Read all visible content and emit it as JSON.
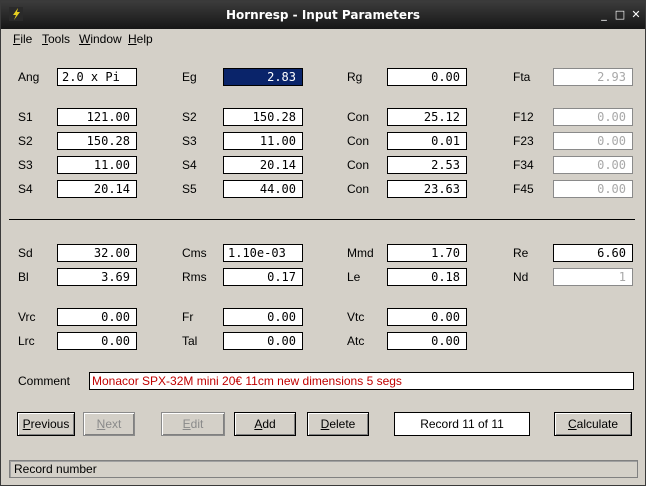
{
  "window": {
    "title": "Hornresp - Input Parameters",
    "minimize": "_",
    "maximize": "□",
    "close": "✕"
  },
  "menu": [
    "File",
    "Tools",
    "Window",
    "Help"
  ],
  "rows": [
    {
      "cells": [
        {
          "label": "Ang",
          "value": "2.0 x Pi",
          "state": "text"
        },
        {
          "label": "Eg",
          "value": "2.83",
          "state": "selected"
        },
        {
          "label": "Rg",
          "value": "0.00",
          "state": "normal"
        },
        {
          "label": "Fta",
          "value": "2.93",
          "state": "disabled"
        }
      ]
    },
    {
      "cells": [
        {
          "label": "S1",
          "value": "121.00",
          "state": "normal"
        },
        {
          "label": "S2",
          "value": "150.28",
          "state": "normal"
        },
        {
          "label": "Con",
          "value": "25.12",
          "state": "normal"
        },
        {
          "label": "F12",
          "value": "0.00",
          "state": "disabled"
        }
      ]
    },
    {
      "cells": [
        {
          "label": "S2",
          "value": "150.28",
          "state": "normal"
        },
        {
          "label": "S3",
          "value": "11.00",
          "state": "normal"
        },
        {
          "label": "Con",
          "value": "0.01",
          "state": "normal"
        },
        {
          "label": "F23",
          "value": "0.00",
          "state": "disabled"
        }
      ]
    },
    {
      "cells": [
        {
          "label": "S3",
          "value": "11.00",
          "state": "normal"
        },
        {
          "label": "S4",
          "value": "20.14",
          "state": "normal"
        },
        {
          "label": "Con",
          "value": "2.53",
          "state": "normal"
        },
        {
          "label": "F34",
          "value": "0.00",
          "state": "disabled"
        }
      ]
    },
    {
      "cells": [
        {
          "label": "S4",
          "value": "20.14",
          "state": "normal"
        },
        {
          "label": "S5",
          "value": "44.00",
          "state": "normal"
        },
        {
          "label": "Con",
          "value": "23.63",
          "state": "normal"
        },
        {
          "label": "F45",
          "value": "0.00",
          "state": "disabled"
        }
      ]
    },
    {
      "cells": [
        {
          "label": "Sd",
          "value": "32.00",
          "state": "normal"
        },
        {
          "label": "Cms",
          "value": "1.10e-03",
          "state": "text"
        },
        {
          "label": "Mmd",
          "value": "1.70",
          "state": "normal"
        },
        {
          "label": "Re",
          "value": "6.60",
          "state": "normal"
        }
      ]
    },
    {
      "cells": [
        {
          "label": "Bl",
          "value": "3.69",
          "state": "normal"
        },
        {
          "label": "Rms",
          "value": "0.17",
          "state": "normal"
        },
        {
          "label": "Le",
          "value": "0.18",
          "state": "normal"
        },
        {
          "label": "Nd",
          "value": "1",
          "state": "disabled"
        }
      ]
    },
    {
      "cells": [
        {
          "label": "Vrc",
          "value": "0.00",
          "state": "normal"
        },
        {
          "label": "Fr",
          "value": "0.00",
          "state": "normal"
        },
        {
          "label": "Vtc",
          "value": "0.00",
          "state": "normal"
        }
      ]
    },
    {
      "cells": [
        {
          "label": "Lrc",
          "value": "0.00",
          "state": "normal"
        },
        {
          "label": "Tal",
          "value": "0.00",
          "state": "normal"
        },
        {
          "label": "Atc",
          "value": "0.00",
          "state": "normal"
        }
      ]
    }
  ],
  "comment": {
    "label": "Comment",
    "value": "Monacor SPX-32M mini 20€ 11cm new dimensions 5 segs"
  },
  "buttons": [
    {
      "name": "previous-button",
      "label": "Previous",
      "enabled": true
    },
    {
      "name": "next-button",
      "label": "Next",
      "enabled": false
    },
    {
      "name": "edit-button",
      "label": "Edit",
      "enabled": false
    },
    {
      "name": "add-button",
      "label": "Add",
      "enabled": true
    },
    {
      "name": "delete-button",
      "label": "Delete",
      "enabled": true
    },
    {
      "name": "calculate-button",
      "label": "Calculate",
      "enabled": true
    }
  ],
  "record": "Record 11 of 11",
  "status": "Record number",
  "colors": {
    "titlebar": "#222222",
    "accent_yellow": "#e8d020",
    "comment_text": "#c00000",
    "selection": "#0a246a"
  }
}
